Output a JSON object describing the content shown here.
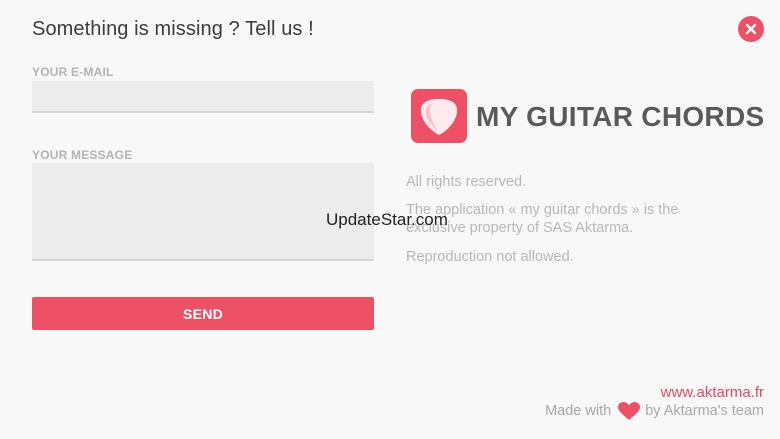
{
  "dialog": {
    "title": "Something is missing ? Tell us !"
  },
  "form": {
    "email_label": "YOUR E-MAIL",
    "email_value": "",
    "message_label": "YOUR MESSAGE",
    "message_value": "",
    "send_label": "SEND"
  },
  "about": {
    "app_name": "MY GUITAR CHORDS",
    "rights": "All rights reserved.",
    "property": "The application « my guitar chords » is the exclusive property of SAS Aktarma.",
    "reproduction": "Reproduction not allowed."
  },
  "overlay": {
    "watermark": "UpdateStar.com"
  },
  "footer": {
    "website": "www.aktarma.fr",
    "made_with_prefix": "Made with",
    "made_with_suffix": "by Aktarma's team"
  },
  "icons": {
    "close": "close-icon",
    "logo": "guitar-pick-icon",
    "heart": "heart-icon"
  },
  "colors": {
    "accent": "#ee5166",
    "title_text": "#3c3c3c",
    "muted_text": "#b8b8b8",
    "background": "#f8f8f8"
  }
}
